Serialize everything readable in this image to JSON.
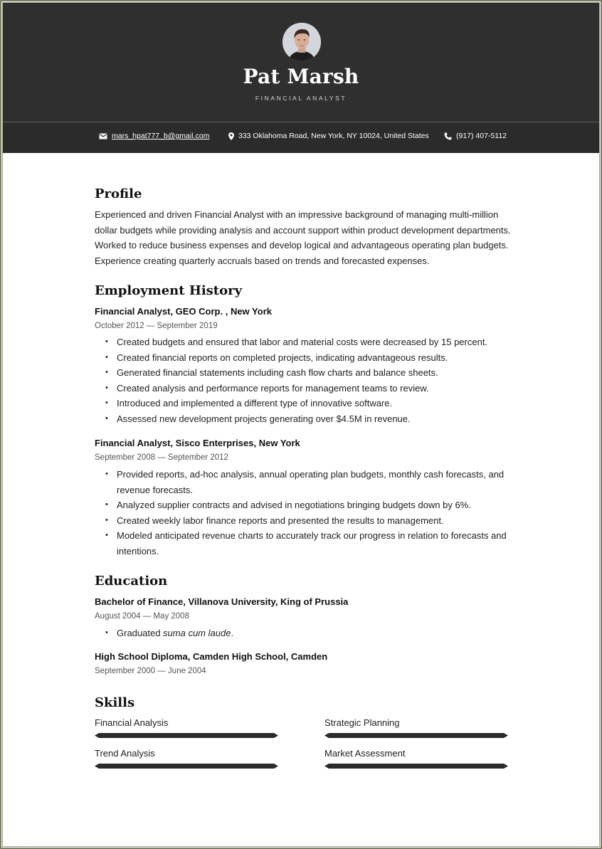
{
  "header": {
    "avatar_alt": "Profile photo of Pat Marsh",
    "name": "Pat Marsh",
    "title": "FINANCIAL ANALYST",
    "colors": {
      "background": "#2f2f2f",
      "contact_bar": "#2b2b2b",
      "text": "#ffffff"
    }
  },
  "contact": {
    "email": {
      "icon": "envelope-icon",
      "value": "mars_hpat777_b@gmail.com"
    },
    "address": {
      "icon": "map-pin-icon",
      "value": "333 Oklahoma Road, New York, NY 10024, United States"
    },
    "phone": {
      "icon": "phone-icon",
      "value": "(917) 407-5112"
    }
  },
  "profile": {
    "heading": "Profile",
    "text": "Experienced and driven Financial Analyst with an impressive background of managing multi-million dollar budgets while providing analysis and account support within product development departments. Worked to reduce business expenses and develop logical and advantageous operating plan budgets. Experience creating quarterly accruals based on trends and forecasted expenses."
  },
  "employment": {
    "heading": "Employment History",
    "jobs": [
      {
        "title": "Financial Analyst, GEO Corp. , New York",
        "dates": "October 2012 — September 2019",
        "bullets": [
          "Created budgets and ensured that labor and material costs were decreased by 15 percent.",
          "Created financial reports on completed projects, indicating advantageous results.",
          "Generated financial statements including cash flow charts and balance sheets.",
          "Created analysis and performance reports for management teams to review.",
          "Introduced and implemented a different type of innovative software.",
          "Assessed new development projects generating over $4.5M in revenue."
        ]
      },
      {
        "title": "Financial Analyst, Sisco Enterprises, New York",
        "dates": "September 2008 — September 2012",
        "bullets": [
          "Provided reports, ad-hoc analysis, annual operating plan budgets, monthly cash forecasts, and revenue forecasts.",
          "Analyzed supplier contracts and advised in negotiations bringing budgets down by 6%.",
          "Created weekly labor finance reports and presented the results to management.",
          "Modeled anticipated revenue charts to accurately track our progress in relation to forecasts and intentions."
        ]
      }
    ]
  },
  "education": {
    "heading": "Education",
    "entries": [
      {
        "title": "Bachelor of Finance, Villanova University, King of Prussia",
        "dates": "August 2004 — May 2008",
        "bullet_prefix": "Graduated ",
        "bullet_italic": "suma cum laude",
        "bullet_suffix": "."
      },
      {
        "title": "High School Diploma, Camden High School, Camden",
        "dates": "September 2000 — June 2004"
      }
    ]
  },
  "skills": {
    "heading": "Skills",
    "bar_color": "#2b2b2b",
    "items": [
      {
        "label": "Financial Analysis",
        "level": 1.0
      },
      {
        "label": "Strategic Planning",
        "level": 1.0
      },
      {
        "label": "Trend Analysis",
        "level": 1.0
      },
      {
        "label": "Market Assessment",
        "level": 1.0
      }
    ]
  }
}
